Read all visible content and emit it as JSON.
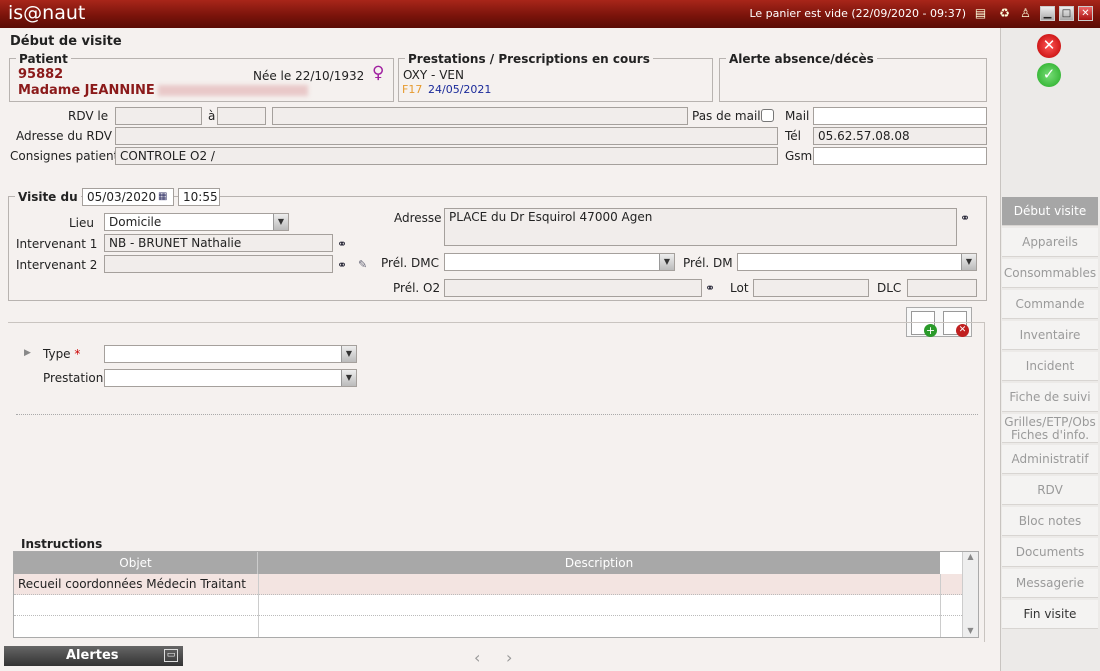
{
  "app": {
    "title": "is@naut",
    "cart_status": "Le panier est vide (22/09/2020 - 09:37)"
  },
  "page_title": "Début de visite",
  "patient": {
    "legend": "Patient",
    "id": "95882",
    "name": "Madame JEANNINE",
    "birth": "Née le 22/10/1932",
    "gender_symbol": "♀"
  },
  "prestations": {
    "legend": "Prestations / Prescriptions en cours",
    "line1": "OXY - VEN",
    "code": "F17",
    "date": "24/05/2021"
  },
  "alerte": {
    "legend": "Alerte absence/décès"
  },
  "rdv": {
    "rdv_le_label": "RDV le",
    "a_label": "à",
    "pas_de_mail_label": "Pas de mail",
    "mail_label": "Mail",
    "adresse_label": "Adresse du RDV",
    "tel_label": "Tél",
    "tel_value": "05.62.57.08.08",
    "consignes_label": "Consignes patient",
    "consignes_value": "CONTROLE O2 /",
    "gsm_label": "Gsm"
  },
  "visite": {
    "legend": "Visite du",
    "date": "05/03/2020",
    "time": "10:55",
    "lieu_label": "Lieu",
    "lieu_value": "Domicile",
    "int1_label": "Intervenant 1",
    "int1_value": "NB - BRUNET Nathalie",
    "int2_label": "Intervenant 2",
    "adresse_label": "Adresse",
    "adresse_value": "PLACE du Dr Esquirol 47000 Agen",
    "prel_dmc_label": "Prél. DMC",
    "prel_dm_label": "Prél. DM",
    "prel_o2_label": "Prél. O2",
    "lot_label": "Lot",
    "dlc_label": "DLC"
  },
  "form": {
    "type_label": "Type",
    "required_mark": "*",
    "prestation_label": "Prestation"
  },
  "instructions": {
    "legend": "Instructions",
    "columns": [
      "Objet",
      "Description"
    ],
    "rows": [
      {
        "objet": "Recueil coordonnées Médecin Traitant",
        "description": ""
      }
    ]
  },
  "bottom": {
    "alertes_label": "Alertes"
  },
  "sidebar": {
    "items": [
      {
        "label": "Début visite"
      },
      {
        "label": "Appareils"
      },
      {
        "label": "Consommables"
      },
      {
        "label": "Commande"
      },
      {
        "label": "Inventaire"
      },
      {
        "label": "Incident"
      },
      {
        "label": "Fiche de suivi"
      },
      {
        "label": "Grilles/ETP/Obs",
        "label2": "Fiches d'info."
      },
      {
        "label": "Administratif"
      },
      {
        "label": "RDV"
      },
      {
        "label": "Bloc notes"
      },
      {
        "label": "Documents"
      },
      {
        "label": "Messagerie"
      },
      {
        "label": "Fin visite"
      }
    ]
  },
  "colors": {
    "titlebar": "#8a1a0f",
    "accent_red": "#8b1a1a",
    "active_tab": "#a6a6a6"
  },
  "icons": [
    "cart-icon",
    "recycle-icon",
    "person-icon",
    "binoculars-icon",
    "close-circle-icon",
    "check-circle-icon",
    "add-doc-icon",
    "remove-doc-icon"
  ]
}
